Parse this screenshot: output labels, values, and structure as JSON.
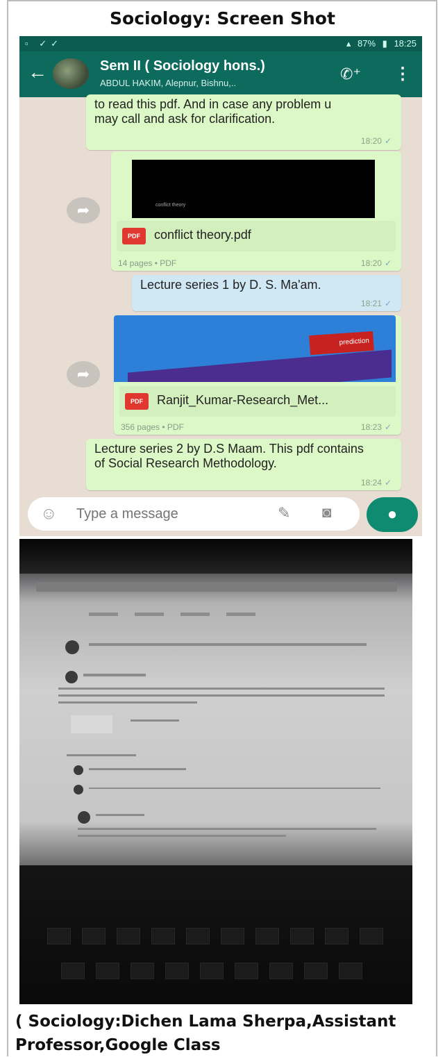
{
  "page": {
    "title": "Sociology: Screen Shot",
    "caption": "( Sociology:Dichen Lama Sherpa,Assistant Professor,Google Class"
  },
  "whatsapp": {
    "statusbar": {
      "battery": "87%",
      "time": "18:25"
    },
    "chat_title": "Sem II ( Sociology hons.)",
    "chat_subtitle": "ABDUL HAKIM, Alepnur, Bishnu,..",
    "messages": [
      {
        "type": "text",
        "text": "to read this pdf. And in case any problem u may call and ask for clarification.",
        "time": "18:20"
      },
      {
        "type": "document",
        "thumb_text": "conflict theory",
        "file_name": "conflict theory.pdf",
        "meta": "14 pages • PDF",
        "time": "18:20"
      },
      {
        "type": "text",
        "text": "Lecture series 1 by D. S. Ma'am.",
        "time": "18:21"
      },
      {
        "type": "document",
        "thumb_text": "prediction",
        "file_name": "Ranjit_Kumar-Research_Met...",
        "meta": "356 pages • PDF",
        "time": "18:23"
      },
      {
        "type": "text",
        "text": "Lecture series 2 by D.S Maam.  This pdf contains of Social Research Methodology.",
        "time": "18:24"
      }
    ],
    "composer": {
      "placeholder": "Type a message"
    },
    "icons": [
      "back-arrow-icon",
      "add-call-icon",
      "more-vert-icon",
      "forward-icon",
      "emoji-icon",
      "attach-icon",
      "camera-icon",
      "mic-icon",
      "pdf-icon",
      "read-ticks-icon"
    ],
    "colors": {
      "header": "#0d6b5e",
      "outgoing_bubble": "#dcf8c6",
      "chat_bg": "#e7ddd3",
      "mic_button": "#0f8b72"
    }
  }
}
